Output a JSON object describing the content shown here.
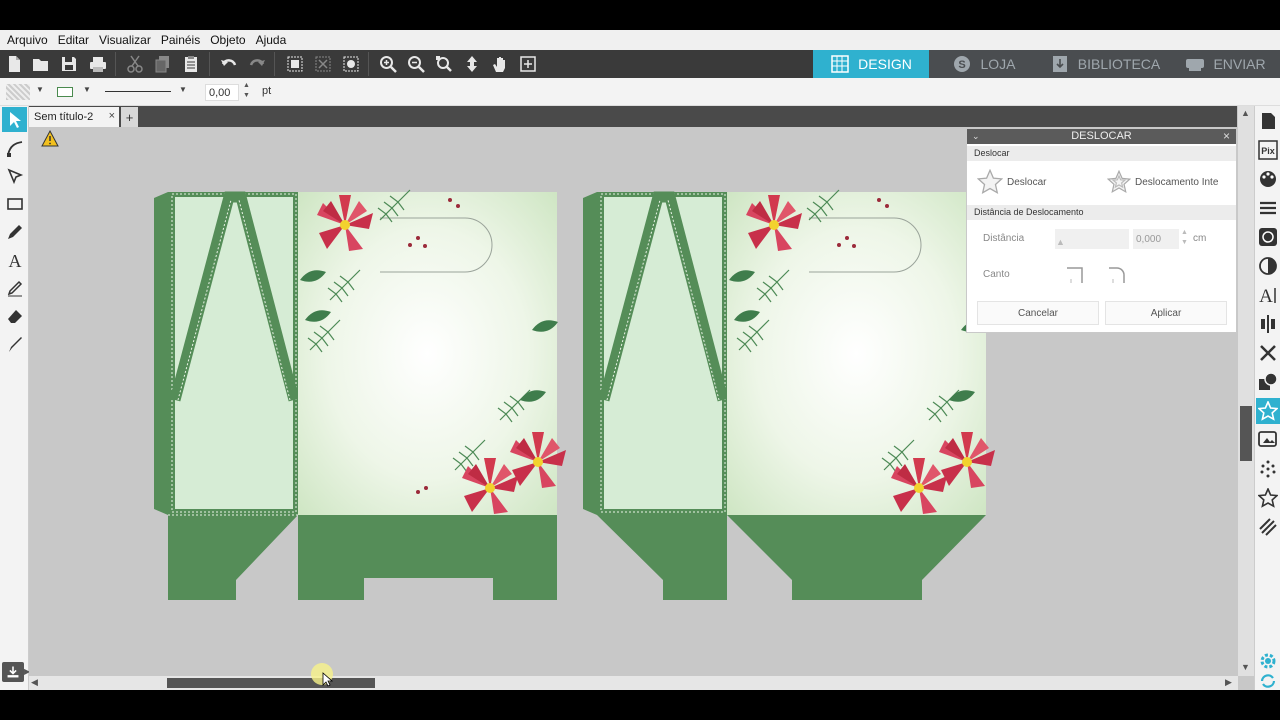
{
  "menu": [
    "Arquivo",
    "Editar",
    "Visualizar",
    "Painéis",
    "Objeto",
    "Ajuda"
  ],
  "modes": [
    {
      "label": "DESIGN",
      "active": true
    },
    {
      "label": "LOJA",
      "active": false
    },
    {
      "label": "BIBLIOTECA",
      "active": false
    },
    {
      "label": "ENVIAR",
      "active": false
    }
  ],
  "options": {
    "line_width_value": "0,00",
    "unit": "pt"
  },
  "document_tab": {
    "title": "Sem título-2",
    "close": "×",
    "add": "+"
  },
  "offset_panel": {
    "title": "DESLOCAR",
    "close": "×",
    "section_offset": "Deslocar",
    "offset_button": "Deslocar",
    "internal_offset_button": "Deslocamento Inte",
    "section_distance": "Distância de Deslocamento",
    "distance_label": "Distância",
    "distance_value": "0,000",
    "distance_unit": "cm",
    "corner_label": "Canto",
    "cancel_button": "Cancelar",
    "apply_button": "Aplicar"
  },
  "colors": {
    "accent": "#2fb1cf",
    "box_green": "#558d58",
    "panel_light": "#d6ecd5",
    "poinsettia_red": "#d23a4e",
    "toolbar_bg": "#3a3a3a"
  },
  "icons": {
    "toolbar": [
      "new-file-icon",
      "open-folder-icon",
      "save-icon",
      "print-icon",
      "cut-icon",
      "copy-icon",
      "paste-icon",
      "undo-icon",
      "redo-icon",
      "group-icon",
      "ungroup-icon",
      "cut-settings-icon",
      "zoom-in-icon",
      "zoom-out-icon",
      "zoom-selection-icon",
      "move-icon",
      "pan-hand-icon",
      "fit-page-icon"
    ],
    "left_tools": [
      "select-arrow-icon",
      "curve-pen-icon",
      "edit-points-icon",
      "rectangle-icon",
      "pencil-icon",
      "text-icon",
      "fill-icon",
      "eraser-icon",
      "knife-icon"
    ],
    "right_panels": [
      "page-setup-icon",
      "pixscan-icon",
      "fill-color-icon",
      "line-style-icon",
      "trace-icon",
      "transform-icon",
      "text-style-icon",
      "align-icon",
      "replicate-icon",
      "modify-icon",
      "offset-icon",
      "trace-image-icon",
      "sketch-icon",
      "star-icon",
      "hatch-icon",
      "settings-gear-icon",
      "refresh-icon"
    ]
  }
}
